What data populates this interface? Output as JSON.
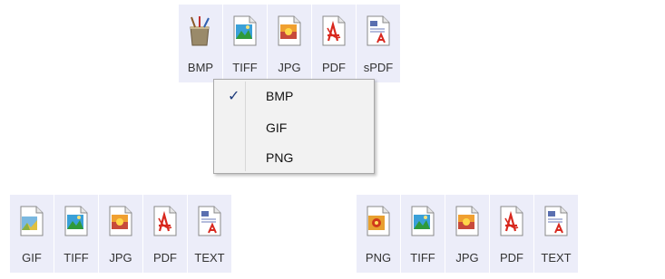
{
  "top_row": [
    {
      "label": "BMP",
      "icon": "bmp-paint-icon"
    },
    {
      "label": "TIFF",
      "icon": "tiff-image-icon"
    },
    {
      "label": "JPG",
      "icon": "jpg-image-icon"
    },
    {
      "label": "PDF",
      "icon": "pdf-file-icon"
    },
    {
      "label": "sPDF",
      "icon": "spdf-file-icon"
    }
  ],
  "menu": {
    "items": [
      {
        "label": "BMP",
        "checked": true
      },
      {
        "label": "GIF",
        "checked": false
      },
      {
        "label": "PNG",
        "checked": false
      }
    ],
    "check_glyph": "✓"
  },
  "left_row": [
    {
      "label": "GIF",
      "icon": "gif-image-icon"
    },
    {
      "label": "TIFF",
      "icon": "tiff-image-icon"
    },
    {
      "label": "JPG",
      "icon": "jpg-image-icon"
    },
    {
      "label": "PDF",
      "icon": "pdf-file-icon"
    },
    {
      "label": "TEXT",
      "icon": "text-file-icon"
    }
  ],
  "right_row": [
    {
      "label": "PNG",
      "icon": "png-image-icon"
    },
    {
      "label": "TIFF",
      "icon": "tiff-image-icon"
    },
    {
      "label": "JPG",
      "icon": "jpg-image-icon"
    },
    {
      "label": "PDF",
      "icon": "pdf-file-icon"
    },
    {
      "label": "TEXT",
      "icon": "text-file-icon"
    }
  ],
  "colors": {
    "tile_bg": "#ecedf9",
    "pdf_red": "#d8281e",
    "check_blue": "#1c3a7a"
  }
}
